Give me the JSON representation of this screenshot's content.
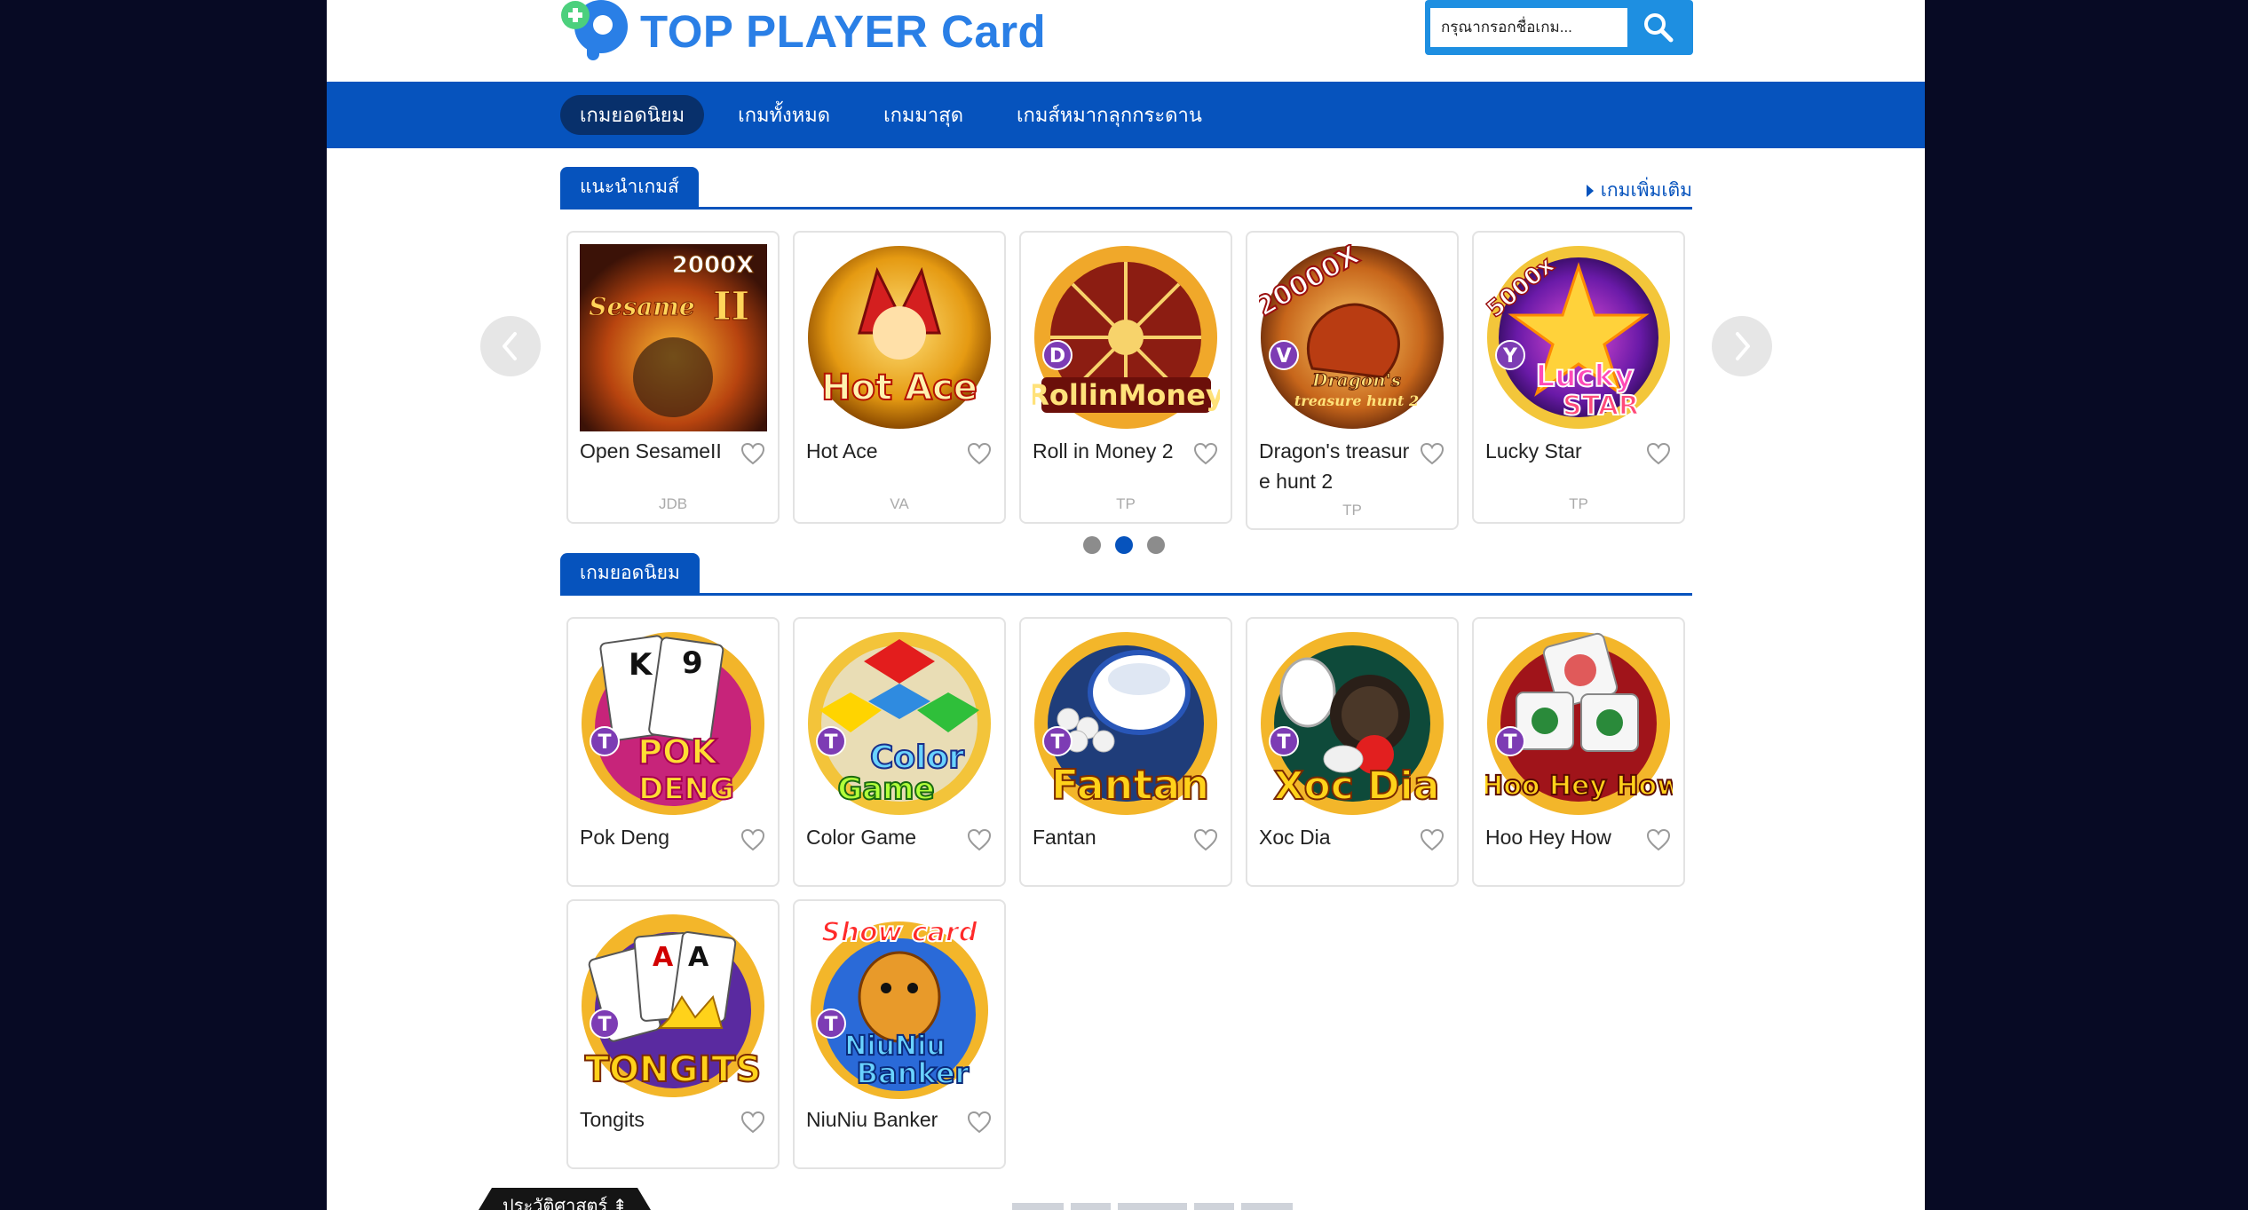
{
  "brand": {
    "name": "TOP PLAYER Card",
    "accent": "#0653bd",
    "logo_color": "#2a7fe6"
  },
  "search": {
    "placeholder": "กรุณากรอกชื่อเกม...",
    "value": "",
    "icon": "search-icon"
  },
  "nav": {
    "items": [
      {
        "label": "เกมยอดนิยม",
        "active": true
      },
      {
        "label": "เกมทั้งหมด",
        "active": false
      },
      {
        "label": "เกมมาสุด",
        "active": false
      },
      {
        "label": "เกมส์หมากลุกกระดาน",
        "active": false
      }
    ]
  },
  "recommended": {
    "title": "แนะนำเกมส์",
    "more_label": "เกมเพิ่มเติม",
    "games": [
      {
        "name": "Open SesameII",
        "provider": "JDB",
        "art_text": "2000X Open Sesame II"
      },
      {
        "name": "Hot Ace",
        "provider": "VA",
        "art_text": "Hot Ace"
      },
      {
        "name": "Roll in Money 2",
        "provider": "TP",
        "art_text": "Roll in Money"
      },
      {
        "name": "Dragon's treasure hunt 2",
        "provider": "TP",
        "art_text": "20000X Dragon's treasure hunt 2"
      },
      {
        "name": "Lucky Star",
        "provider": "TP",
        "art_text": "5000x Lucky Star"
      }
    ],
    "carousel": {
      "pages": 3,
      "current_page": 2
    }
  },
  "popular": {
    "title": "เกมยอดนิยม",
    "games": [
      {
        "name": "Pok Deng",
        "art_text": "POK DENG"
      },
      {
        "name": "Color Game",
        "art_text": "Color Game"
      },
      {
        "name": "Fantan",
        "art_text": "Fantan"
      },
      {
        "name": "Xoc Dia",
        "art_text": "Xoc Dia"
      },
      {
        "name": "Hoo Hey How",
        "art_text": "Hoo Hey How"
      },
      {
        "name": "Tongits",
        "art_text": "TONGITS"
      },
      {
        "name": "NiuNiu Banker",
        "art_text": "Show card NiuNiu Banker"
      }
    ]
  },
  "footer": {
    "history_label": "ประวัติศาสตร์ ⇞"
  }
}
